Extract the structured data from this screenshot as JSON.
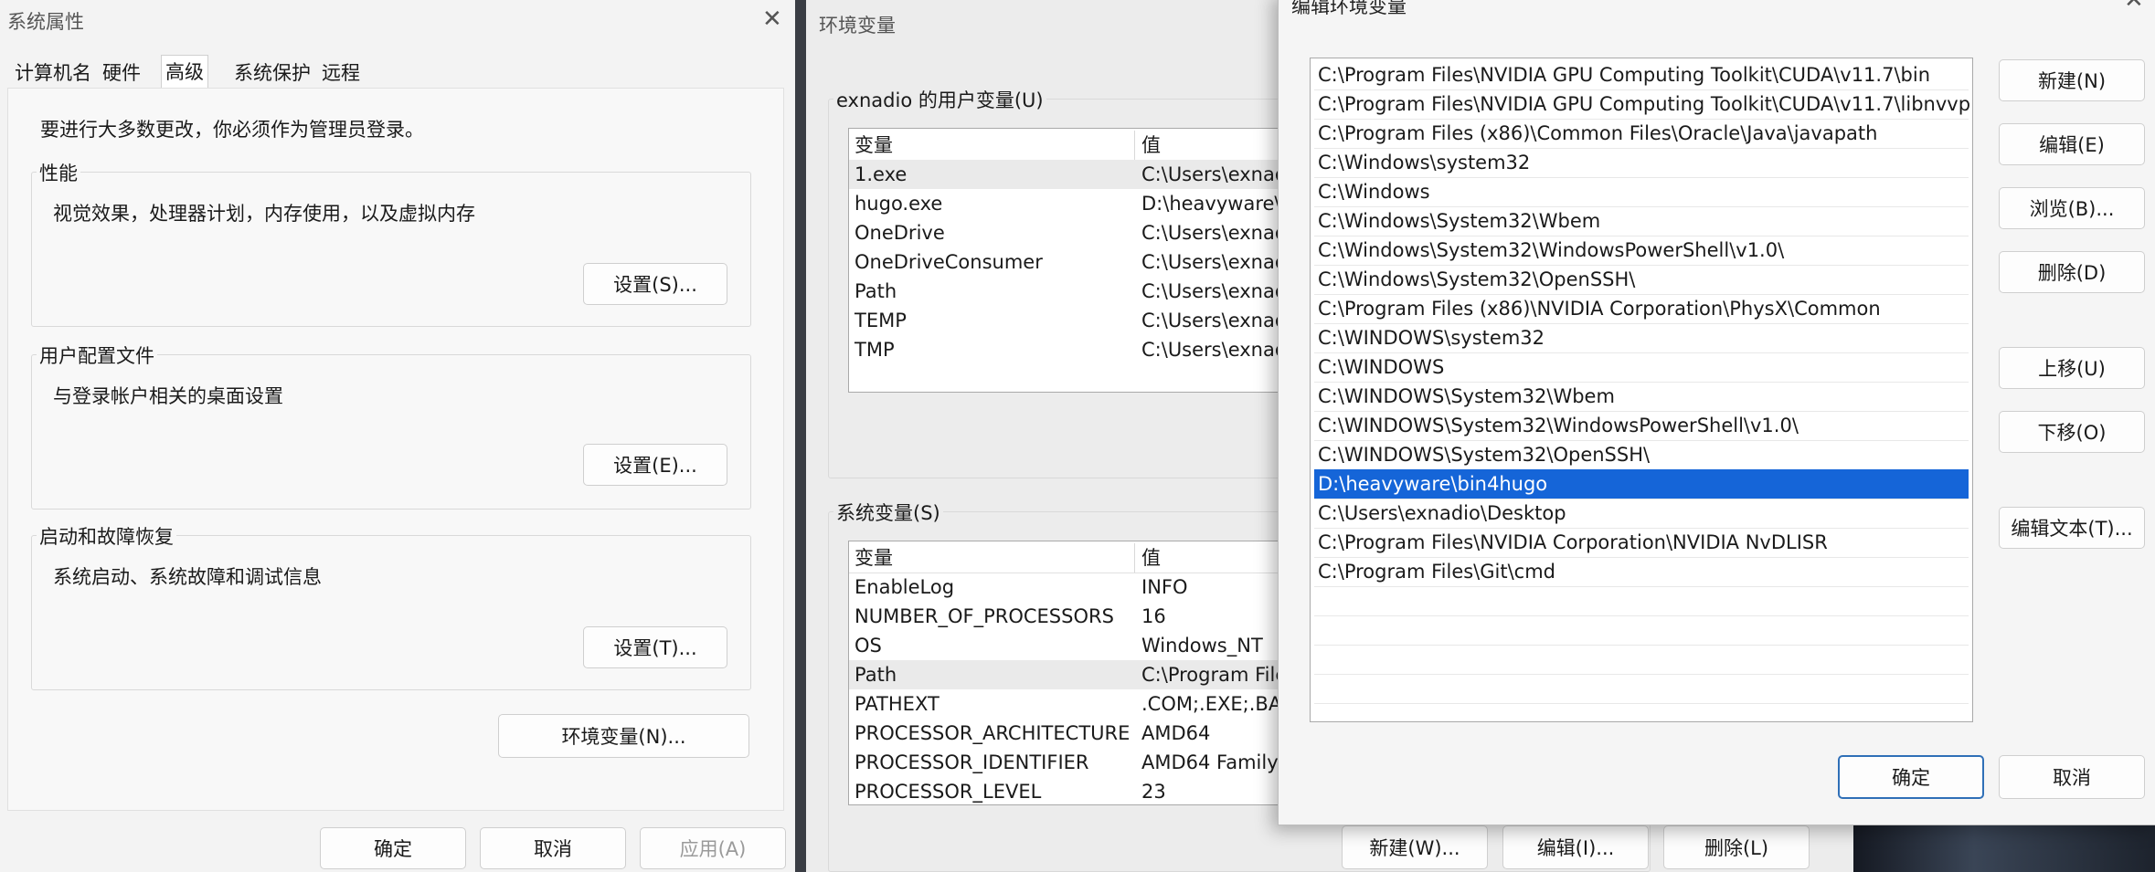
{
  "sysprops": {
    "title": "系统属性",
    "close": "✕",
    "tabs": [
      "计算机名",
      "硬件",
      "高级",
      "系统保护",
      "远程"
    ],
    "admin_note": "要进行大多数更改，你必须作为管理员登录。",
    "performance": {
      "label": "性能",
      "desc": "视觉效果，处理器计划，内存使用，以及虚拟内存",
      "button": "设置(S)..."
    },
    "profile": {
      "label": "用户配置文件",
      "desc": "与登录帐户相关的桌面设置",
      "button": "设置(E)..."
    },
    "startup": {
      "label": "启动和故障恢复",
      "desc": "系统启动、系统故障和调试信息",
      "button": "设置(T)..."
    },
    "env_button": "环境变量(N)...",
    "ok": "确定",
    "cancel": "取消",
    "apply": "应用(A)"
  },
  "envvars": {
    "title": "环境变量",
    "user_label": "exnadio 的用户变量(U)",
    "col_var": "变量",
    "col_val": "值",
    "user_rows": [
      {
        "name": "1.exe",
        "value": "C:\\Users\\exnad"
      },
      {
        "name": "hugo.exe",
        "value": "D:\\heavyware\\"
      },
      {
        "name": "OneDrive",
        "value": "C:\\Users\\exnad"
      },
      {
        "name": "OneDriveConsumer",
        "value": "C:\\Users\\exnad"
      },
      {
        "name": "Path",
        "value": "C:\\Users\\exnad"
      },
      {
        "name": "TEMP",
        "value": "C:\\Users\\exnad"
      },
      {
        "name": "TMP",
        "value": "C:\\Users\\exnad"
      }
    ],
    "sys_label": "系统变量(S)",
    "sys_rows": [
      {
        "name": "EnableLog",
        "value": "INFO"
      },
      {
        "name": "NUMBER_OF_PROCESSORS",
        "value": "16"
      },
      {
        "name": "OS",
        "value": "Windows_NT"
      },
      {
        "name": "Path",
        "value": "C:\\Program File"
      },
      {
        "name": "PATHEXT",
        "value": ".COM;.EXE;.BAT"
      },
      {
        "name": "PROCESSOR_ARCHITECTURE",
        "value": "AMD64"
      },
      {
        "name": "PROCESSOR_IDENTIFIER",
        "value": "AMD64 Family"
      },
      {
        "name": "PROCESSOR_LEVEL",
        "value": "23"
      }
    ],
    "new_btn": "新建(W)...",
    "edit_btn": "编辑(I)...",
    "delete_btn": "删除(L)"
  },
  "editenv": {
    "title": "编辑环境变量",
    "close": "✕",
    "paths": [
      "C:\\Program Files\\NVIDIA GPU Computing Toolkit\\CUDA\\v11.7\\bin",
      "C:\\Program Files\\NVIDIA GPU Computing Toolkit\\CUDA\\v11.7\\libnvvp",
      "C:\\Program Files (x86)\\Common Files\\Oracle\\Java\\javapath",
      "C:\\Windows\\system32",
      "C:\\Windows",
      "C:\\Windows\\System32\\Wbem",
      "C:\\Windows\\System32\\WindowsPowerShell\\v1.0\\",
      "C:\\Windows\\System32\\OpenSSH\\",
      "C:\\Program Files (x86)\\NVIDIA Corporation\\PhysX\\Common",
      "C:\\WINDOWS\\system32",
      "C:\\WINDOWS",
      "C:\\WINDOWS\\System32\\Wbem",
      "C:\\WINDOWS\\System32\\WindowsPowerShell\\v1.0\\",
      "C:\\WINDOWS\\System32\\OpenSSH\\",
      "D:\\heavyware\\bin4hugo",
      "C:\\Users\\exnadio\\Desktop",
      "C:\\Program Files\\NVIDIA Corporation\\NVIDIA NvDLISR",
      "C:\\Program Files\\Git\\cmd"
    ],
    "selected_index": 14,
    "buttons": {
      "new": "新建(N)",
      "edit": "编辑(E)",
      "browse": "浏览(B)...",
      "delete": "删除(D)",
      "up": "上移(U)",
      "down": "下移(O)",
      "edit_text": "编辑文本(T)..."
    },
    "ok": "确定",
    "cancel": "取消"
  },
  "colors": {
    "selection": "#1565d8",
    "primary_border": "#2f6fb7",
    "window_bg": "#f3f3f3"
  }
}
